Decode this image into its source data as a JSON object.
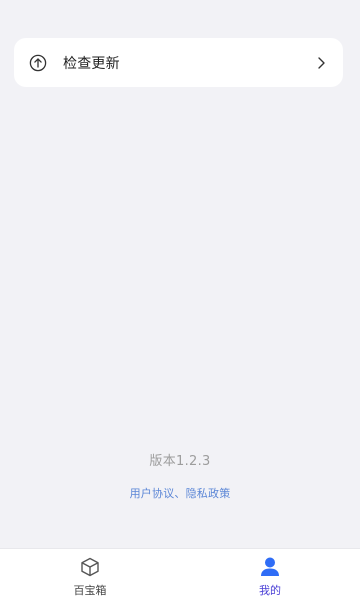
{
  "menu": {
    "items": [
      {
        "label": "检查更新",
        "icon": "arrow-up-circle-icon",
        "chevron": "chevron-right-icon"
      }
    ]
  },
  "footer": {
    "version": "版本1.2.3",
    "links_text": "用户协议、隐私政策"
  },
  "tabbar": {
    "tabs": [
      {
        "label": "百宝箱",
        "icon": "cube-icon",
        "active": false
      },
      {
        "label": "我的",
        "icon": "user-icon",
        "active": true
      }
    ]
  },
  "colors": {
    "background": "#f2f2f6",
    "accent": "#4a3fd6",
    "user_icon_blue": "#2f6df6",
    "link": "#5b86d6"
  }
}
